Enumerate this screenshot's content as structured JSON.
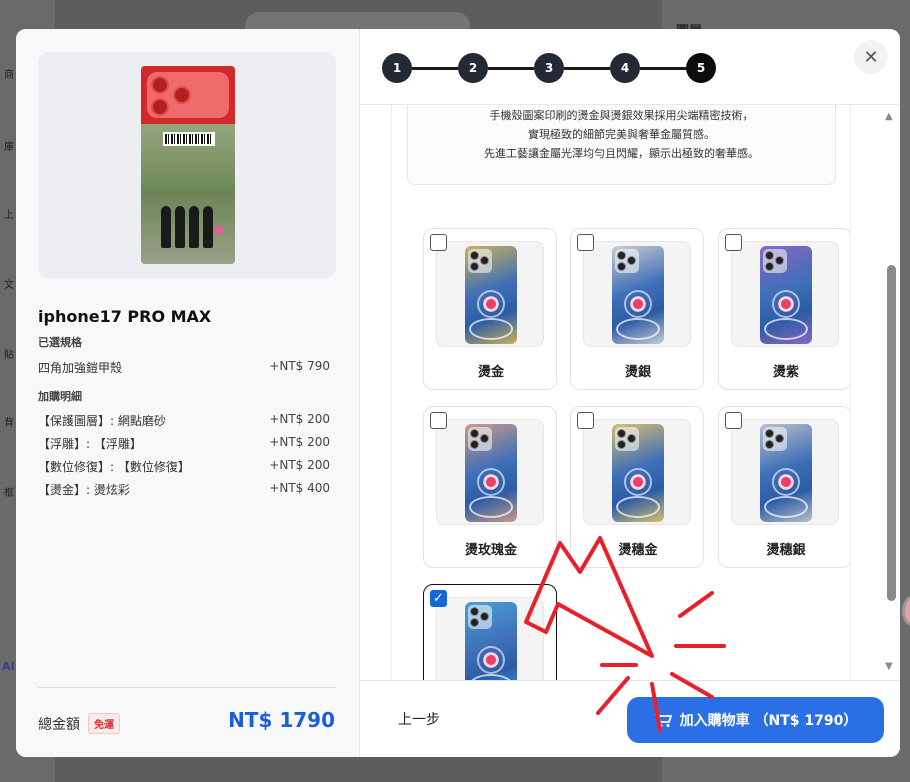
{
  "background": {
    "right_panel_title": "圖層",
    "left_items": [
      "商",
      "庫",
      "上",
      "文",
      "貼",
      "背",
      "框",
      "AI"
    ],
    "ai_label": "AI"
  },
  "steps": [
    "1",
    "2",
    "3",
    "4",
    "5"
  ],
  "active_step": "5",
  "summary": {
    "product_name": "iphone17 PRO MAX",
    "spec_heading": "已選規格",
    "spec": {
      "label": "四角加強鎧甲殼",
      "price": "+NT$ 790"
    },
    "addon_heading": "加購明細",
    "addons": [
      {
        "label": "【保護圖層】: 網點磨砂",
        "price": "+NT$ 200"
      },
      {
        "label": "【浮雕】: 【浮雕】",
        "price": "+NT$ 200"
      },
      {
        "label": "【數位修復】: 【數位修復】",
        "price": "+NT$ 200"
      },
      {
        "label": "【燙金】: 燙炫彩",
        "price": "+NT$ 400"
      }
    ],
    "total_label": "總金額",
    "free_shipping": "免運",
    "total_value": "NT$ 1790"
  },
  "info_text": [
    "手機殼圖案印刷的燙金與燙銀效果採用尖端精密技術，",
    "實現極致的細節完美與奢華金屬質感。",
    "先進工藝讓金屬光澤均勻且閃耀，顯示出極致的奢華感。"
  ],
  "options": [
    {
      "label": "燙金",
      "checked": false,
      "tint": "#c9b25a"
    },
    {
      "label": "燙銀",
      "checked": false,
      "tint": "#c8ccd2"
    },
    {
      "label": "燙紫",
      "checked": false,
      "tint": "#8a66c2"
    },
    {
      "label": "燙玫瑰金",
      "checked": false,
      "tint": "#c99a86"
    },
    {
      "label": "燙穗金",
      "checked": false,
      "tint": "#d6c070"
    },
    {
      "label": "燙穗銀",
      "checked": false,
      "tint": "#b8c0c8"
    },
    {
      "label": "",
      "checked": true,
      "tint": "#4aa0d8"
    }
  ],
  "footer": {
    "back_label": "上一步",
    "cart_label": "加入購物車 （NT$ 1790）"
  },
  "colors": {
    "accent": "#2a6fe6",
    "total": "#1a5fd6",
    "annotation": "#e8202a"
  }
}
